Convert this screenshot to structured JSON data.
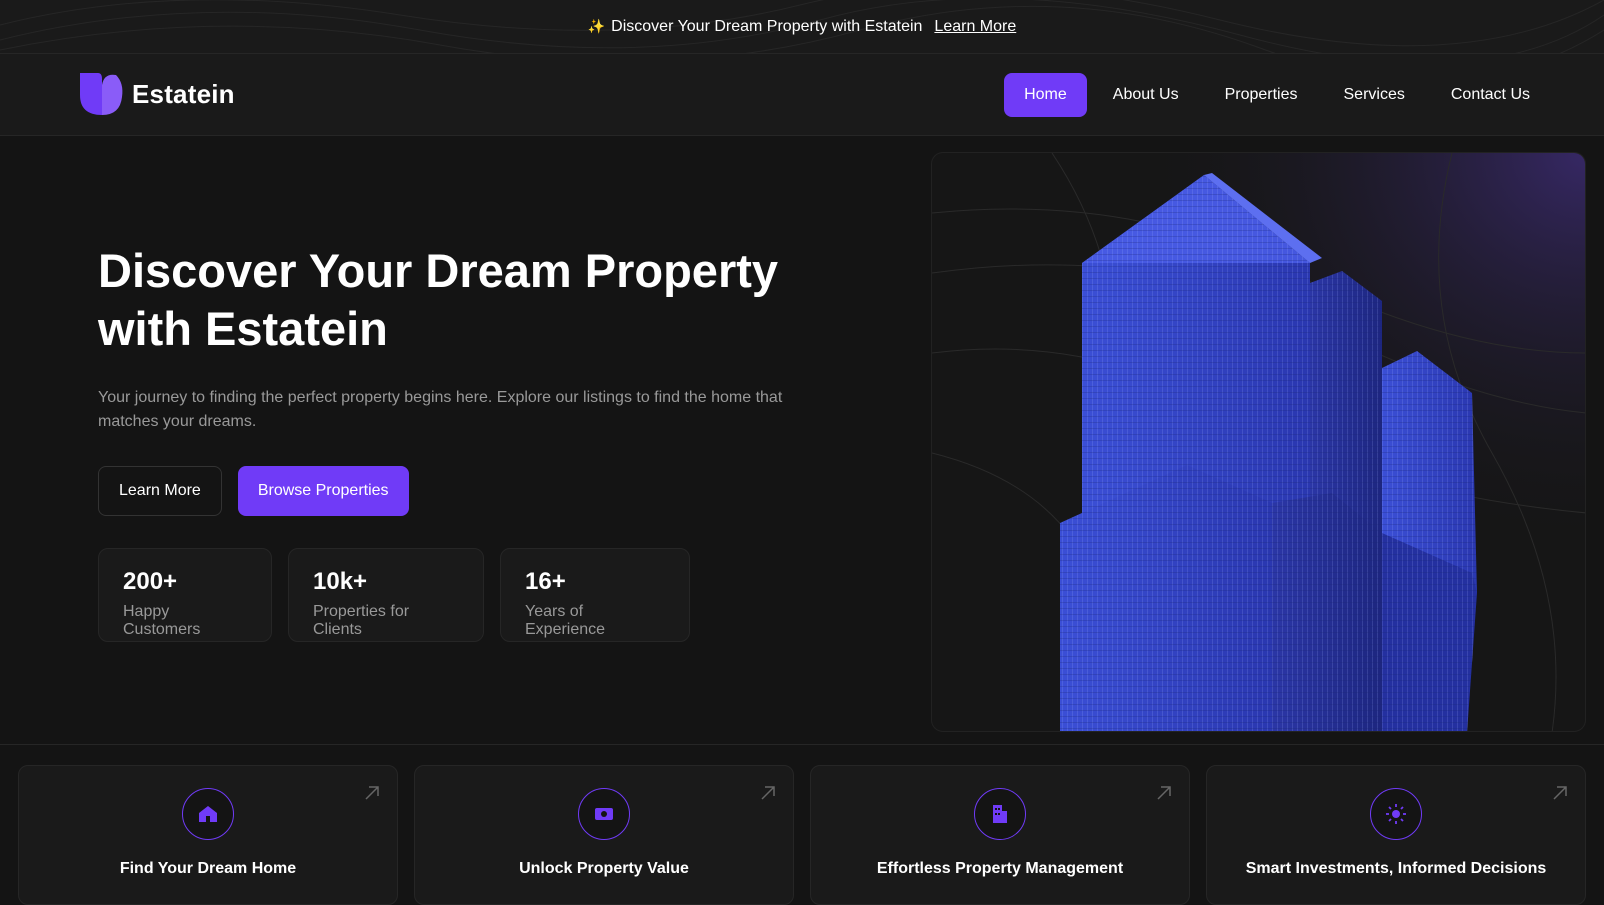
{
  "announcement": {
    "sparkle": "✨",
    "message": "Discover Your Dream Property with Estatein",
    "link": "Learn More"
  },
  "brand": {
    "name": "Estatein",
    "accent": "#703bf7"
  },
  "nav": {
    "items": [
      {
        "label": "Home",
        "active": true
      },
      {
        "label": "About Us",
        "active": false
      },
      {
        "label": "Properties",
        "active": false
      },
      {
        "label": "Services",
        "active": false
      },
      {
        "label": "Contact Us",
        "active": false
      }
    ]
  },
  "hero": {
    "title_line1": "Discover Your Dream Property",
    "title_line2": "with Estatein",
    "subtitle": "Your journey to finding the perfect property begins here. Explore our listings to find the home that matches your dreams.",
    "secondary_button": "Learn More",
    "primary_button": "Browse Properties",
    "stats": [
      {
        "value": "200+",
        "label": "Happy Customers"
      },
      {
        "value": "10k+",
        "label": "Properties for Clients"
      },
      {
        "value": "16+",
        "label": "Years of Experience"
      }
    ],
    "image_icon": "skyscraper-image"
  },
  "features": [
    {
      "title": "Find Your Dream Home",
      "icon": "home-icon"
    },
    {
      "title": "Unlock Property Value",
      "icon": "money-icon"
    },
    {
      "title": "Effortless Property Management",
      "icon": "building-icon"
    },
    {
      "title": "Smart Investments, Informed Decisions",
      "icon": "sun-icon"
    }
  ]
}
